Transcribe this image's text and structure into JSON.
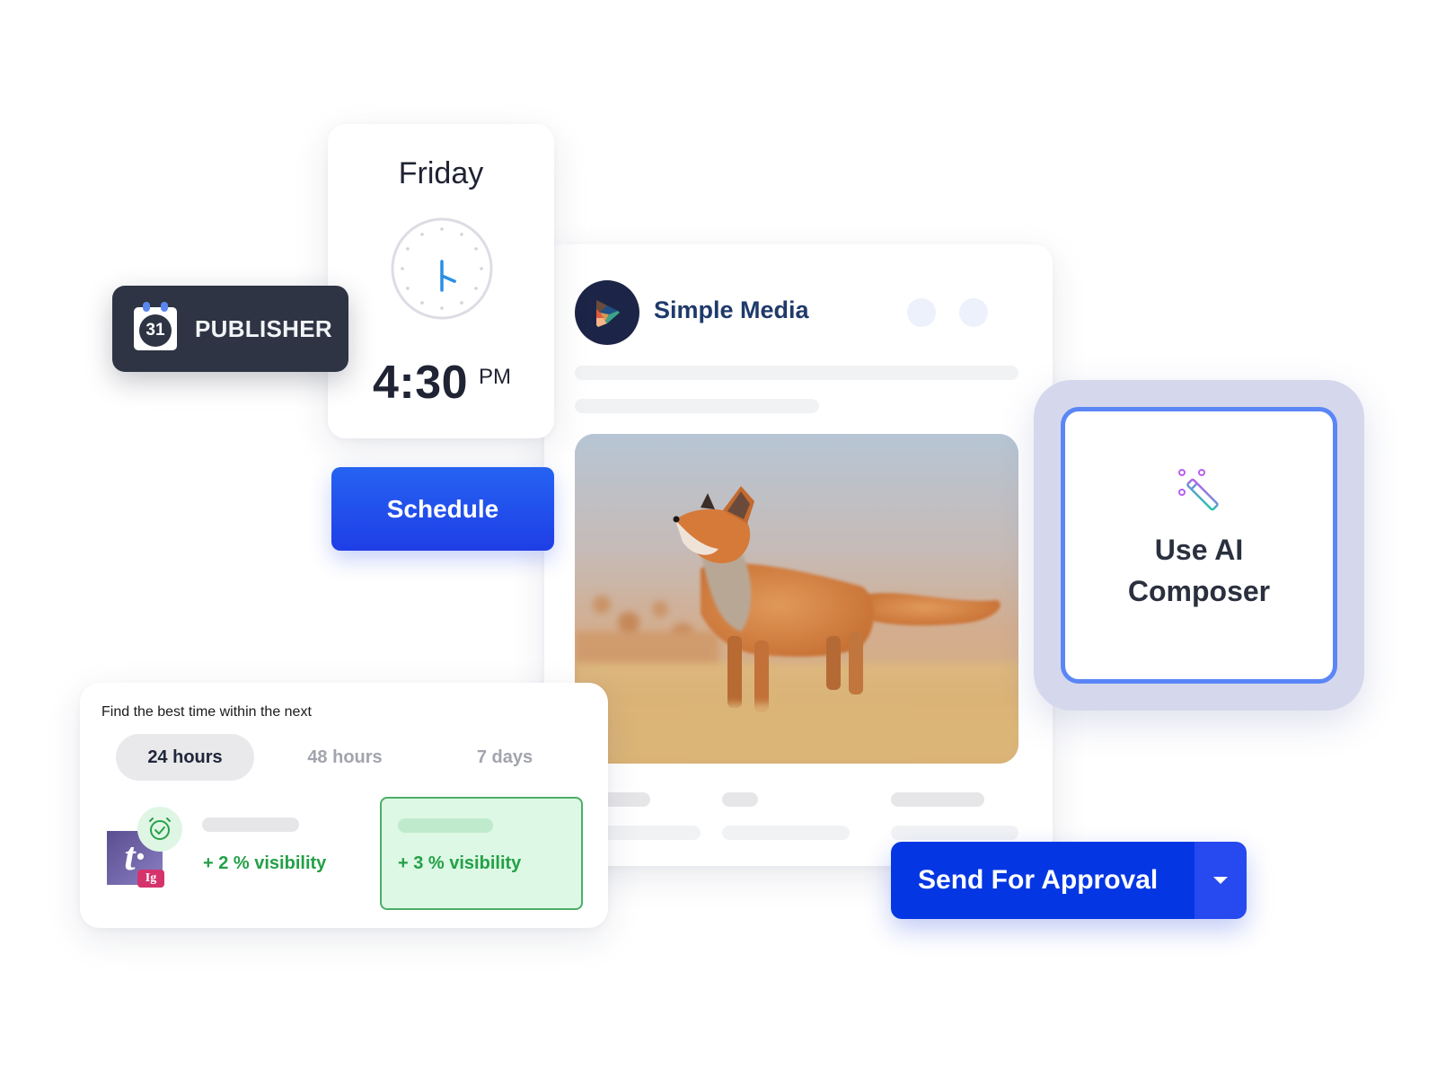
{
  "publisher": {
    "calendar_day": "31",
    "label": "PUBLISHER"
  },
  "schedule_card": {
    "day": "Friday",
    "time": "4:30",
    "meridiem": "PM",
    "clock": {
      "hour": 4,
      "minute": 30
    },
    "schedule_label": "Schedule"
  },
  "post_card": {
    "account_name": "Simple Media",
    "image_alt": "Red fox standing in golden grass looking up"
  },
  "ai_composer": {
    "line1": "Use AI",
    "line2": "Composer",
    "icon": "magic-wand-icon"
  },
  "best_time": {
    "title": "Find the best time within the next",
    "ranges": [
      {
        "label": "24 hours",
        "active": true
      },
      {
        "label": "48 hours",
        "active": false
      },
      {
        "label": "7 days",
        "active": false
      }
    ],
    "network_badge": "Ig",
    "slots": [
      {
        "visibility": "+ 2 % visibility",
        "selected": false
      },
      {
        "visibility": "+ 3 % visibility",
        "selected": true
      }
    ]
  },
  "approval": {
    "send_label": "Send For Approval",
    "dropdown_icon": "caret-down-icon"
  },
  "colors": {
    "primary": "#0437e3",
    "schedule_blue": "#1f4ae8",
    "ai_border": "#5b86f6",
    "success_green": "#23a047",
    "badge_dark": "#2e3443",
    "brand_navy": "#1f3a6b"
  }
}
